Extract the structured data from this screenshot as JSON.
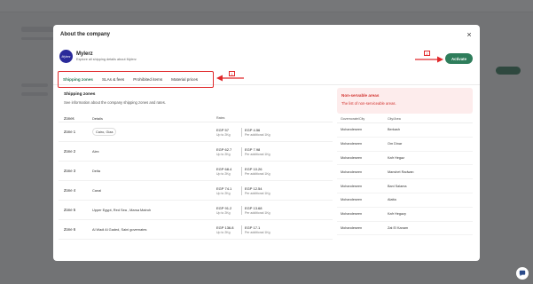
{
  "modal": {
    "title": "About the company",
    "close_label": "×"
  },
  "company": {
    "avatar_text": "Mylerz",
    "name": "Mylerz",
    "subtitle": "Explore all shipping details about Mylerz"
  },
  "activate_label": "Activate",
  "tabs": [
    {
      "label": "Shipping zones",
      "active": true
    },
    {
      "label": "SLAs & fees",
      "active": false
    },
    {
      "label": "Prohibited items",
      "active": false
    },
    {
      "label": "Material prices",
      "active": false
    }
  ],
  "annotations": {
    "badge1": "1",
    "badge2": "2"
  },
  "shipping_zones": {
    "title": "Shipping zones",
    "subtitle": "See information about the company shipping zones and rates.",
    "headers": {
      "zones": "Zones",
      "details": "Details",
      "rates": "Rates"
    },
    "rows": [
      {
        "zone": "Zone 1",
        "details": "Cairo, Giza",
        "pill": true,
        "rate1": "EGP 57",
        "rate1_sub": "Up to 2Kg",
        "rate2": "EGP 4.56",
        "rate2_sub": "Per additional 1Kg"
      },
      {
        "zone": "Zone 2",
        "details": "Alex",
        "pill": false,
        "rate1": "EGP 62.7",
        "rate1_sub": "Up to 2Kg",
        "rate2": "EGP 7.98",
        "rate2_sub": "Per additional 1Kg"
      },
      {
        "zone": "Zone 3",
        "details": "Delta",
        "pill": false,
        "rate1": "EGP 68.4",
        "rate1_sub": "Up to 2Kg",
        "rate2": "EGP 10.26",
        "rate2_sub": "Per additional 1Kg"
      },
      {
        "zone": "Zone 4",
        "details": "Canal",
        "pill": false,
        "rate1": "EGP 74.1",
        "rate1_sub": "Up to 2Kg",
        "rate2": "EGP 12.54",
        "rate2_sub": "Per additional 1Kg"
      },
      {
        "zone": "Zone 5",
        "details": "Upper Egypt, Red Sea , Marsa Matroh",
        "pill": false,
        "rate1": "EGP 91.2",
        "rate1_sub": "Up to 2Kg",
        "rate2": "EGP 13.68",
        "rate2_sub": "Per additional 1Kg"
      },
      {
        "zone": "Zone 6",
        "details": "Al Wadi Al Gaded, Saini governates",
        "pill": false,
        "rate1": "EGP 136.8",
        "rate1_sub": "Up to 2Kg",
        "rate2": "EGP 17.1",
        "rate2_sub": "Per additional 1Kg"
      }
    ]
  },
  "non_serviceable": {
    "title": "Non-servable areas",
    "subtitle": "The list of non-serviceable areas.",
    "headers": {
      "governorate": "Governorate/City",
      "area": "City/Area"
    },
    "rows": [
      {
        "governorate": "Mohandeseen",
        "area": "Berkash"
      },
      {
        "governorate": "Mohandeseen",
        "area": "Om Dinar"
      },
      {
        "governorate": "Mohandeseen",
        "area": "Kafr Hegaz"
      },
      {
        "governorate": "Mohandeseen",
        "area": "Manshet Radwan"
      },
      {
        "governorate": "Mohandeseen",
        "area": "Bani Salama"
      },
      {
        "governorate": "Mohandeseen",
        "area": "Alatta"
      },
      {
        "governorate": "Mohandeseen",
        "area": "Kafr Hegazy"
      },
      {
        "governorate": "Mohandeseen",
        "area": "Zat El Kanam"
      }
    ]
  },
  "colors": {
    "brand_green": "#2e7d5b",
    "annotation_red": "#e0282a",
    "error_red": "#d2332f"
  }
}
